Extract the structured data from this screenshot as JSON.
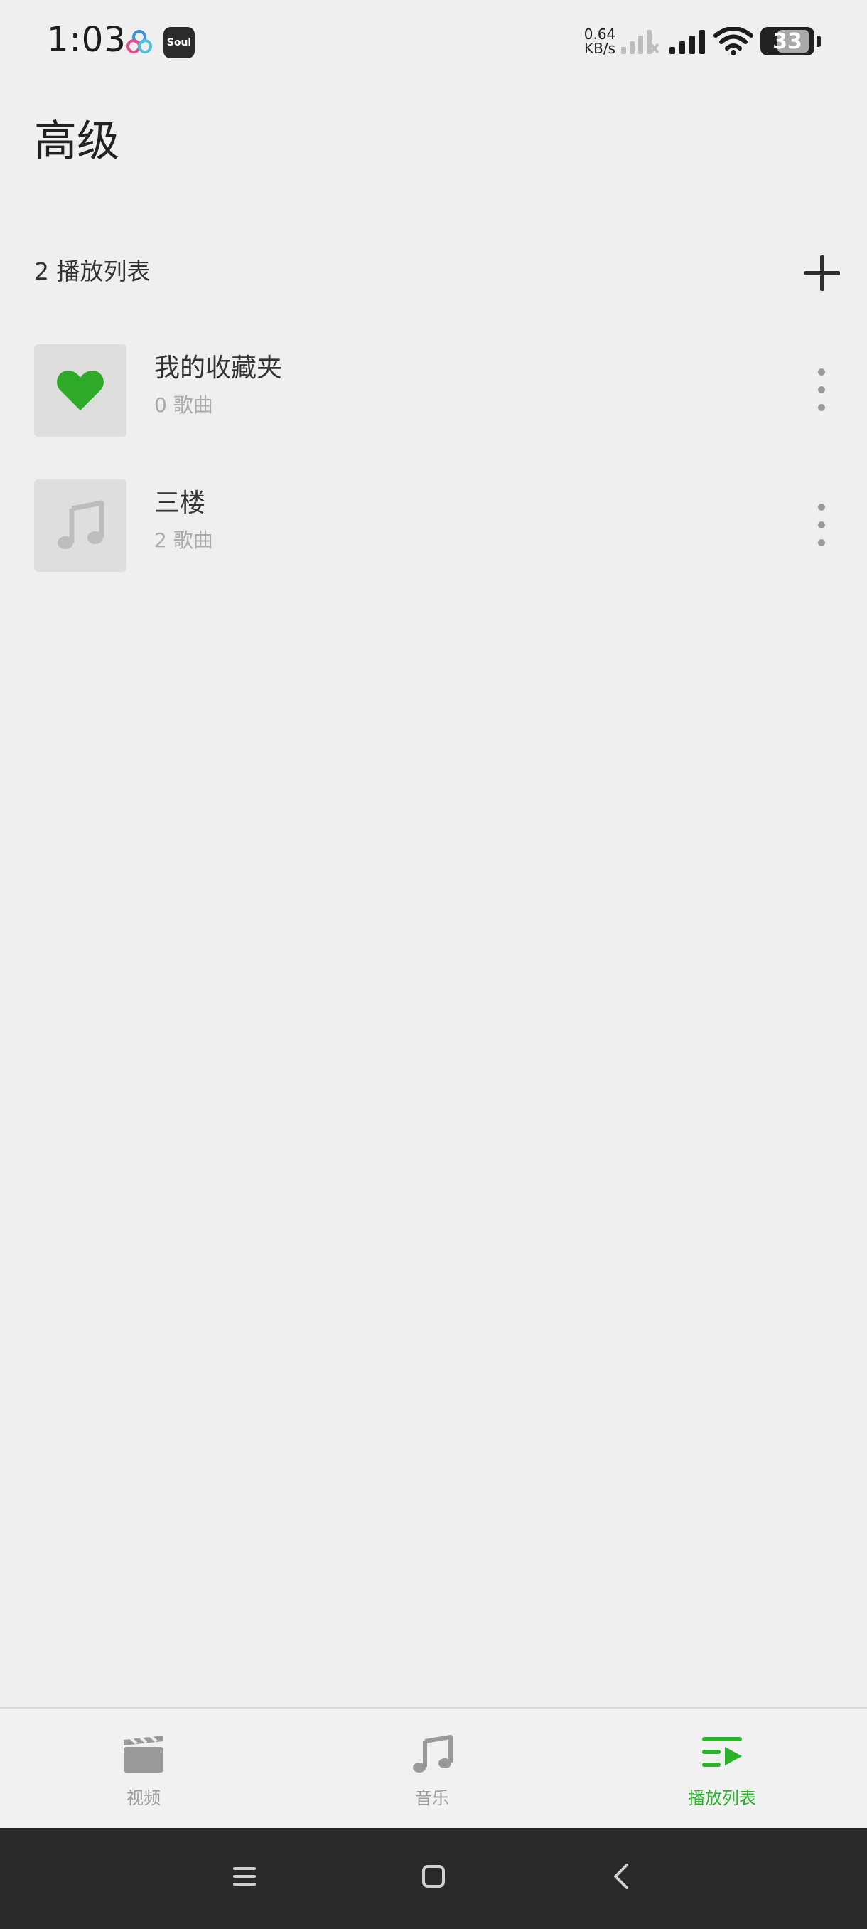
{
  "status_bar": {
    "time": "1:03",
    "net_speed_value": "0.64",
    "net_speed_unit": "KB/s",
    "battery_level": "33"
  },
  "header": {
    "title": "高级"
  },
  "section": {
    "count_label": "2 播放列表"
  },
  "playlists": [
    {
      "title": "我的收藏夹",
      "subtitle": "0 歌曲",
      "icon": "heart-icon"
    },
    {
      "title": "三楼",
      "subtitle": "2 歌曲",
      "icon": "music-note-icon"
    }
  ],
  "bottom_nav": {
    "tabs": [
      {
        "label": "视频",
        "icon": "clapperboard-icon",
        "active": false
      },
      {
        "label": "音乐",
        "icon": "music-note-icon",
        "active": false
      },
      {
        "label": "播放列表",
        "icon": "playlist-icon",
        "active": true
      }
    ]
  },
  "colors": {
    "background": "#efefef",
    "accent": "#2bb32b",
    "muted_text": "#ababab",
    "nav_bar": "#2a2a2a"
  }
}
